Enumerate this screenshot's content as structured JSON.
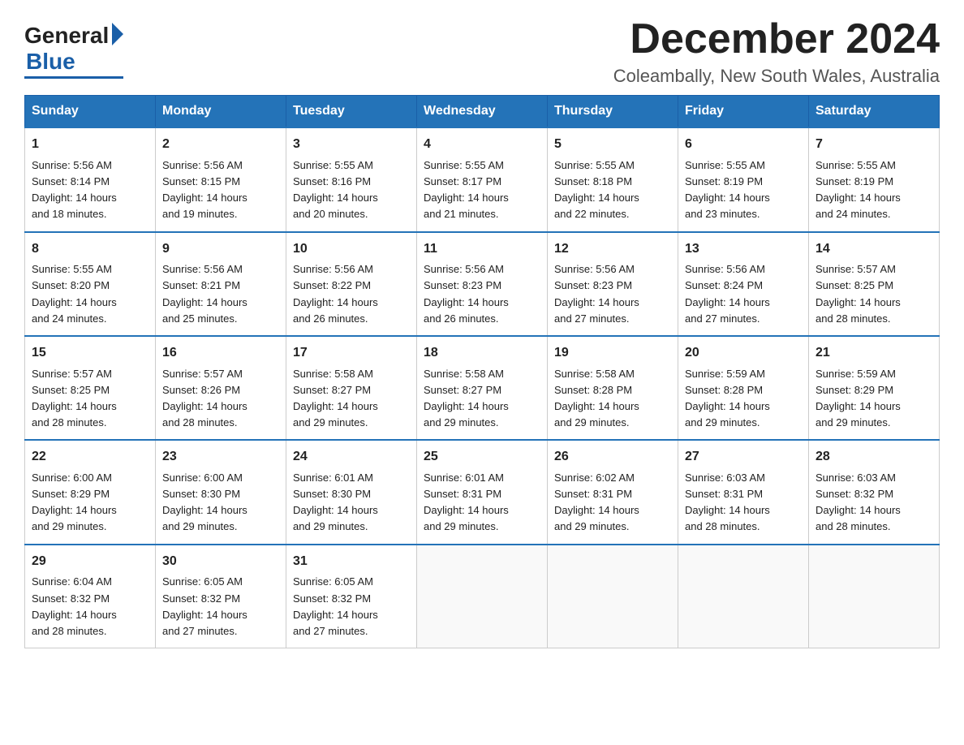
{
  "header": {
    "logo_general": "General",
    "logo_blue": "Blue",
    "month_title": "December 2024",
    "location": "Coleambally, New South Wales, Australia"
  },
  "days_of_week": [
    "Sunday",
    "Monday",
    "Tuesday",
    "Wednesday",
    "Thursday",
    "Friday",
    "Saturday"
  ],
  "weeks": [
    [
      {
        "day": "1",
        "sunrise": "5:56 AM",
        "sunset": "8:14 PM",
        "daylight": "14 hours and 18 minutes."
      },
      {
        "day": "2",
        "sunrise": "5:56 AM",
        "sunset": "8:15 PM",
        "daylight": "14 hours and 19 minutes."
      },
      {
        "day": "3",
        "sunrise": "5:55 AM",
        "sunset": "8:16 PM",
        "daylight": "14 hours and 20 minutes."
      },
      {
        "day": "4",
        "sunrise": "5:55 AM",
        "sunset": "8:17 PM",
        "daylight": "14 hours and 21 minutes."
      },
      {
        "day": "5",
        "sunrise": "5:55 AM",
        "sunset": "8:18 PM",
        "daylight": "14 hours and 22 minutes."
      },
      {
        "day": "6",
        "sunrise": "5:55 AM",
        "sunset": "8:19 PM",
        "daylight": "14 hours and 23 minutes."
      },
      {
        "day": "7",
        "sunrise": "5:55 AM",
        "sunset": "8:19 PM",
        "daylight": "14 hours and 24 minutes."
      }
    ],
    [
      {
        "day": "8",
        "sunrise": "5:55 AM",
        "sunset": "8:20 PM",
        "daylight": "14 hours and 24 minutes."
      },
      {
        "day": "9",
        "sunrise": "5:56 AM",
        "sunset": "8:21 PM",
        "daylight": "14 hours and 25 minutes."
      },
      {
        "day": "10",
        "sunrise": "5:56 AM",
        "sunset": "8:22 PM",
        "daylight": "14 hours and 26 minutes."
      },
      {
        "day": "11",
        "sunrise": "5:56 AM",
        "sunset": "8:23 PM",
        "daylight": "14 hours and 26 minutes."
      },
      {
        "day": "12",
        "sunrise": "5:56 AM",
        "sunset": "8:23 PM",
        "daylight": "14 hours and 27 minutes."
      },
      {
        "day": "13",
        "sunrise": "5:56 AM",
        "sunset": "8:24 PM",
        "daylight": "14 hours and 27 minutes."
      },
      {
        "day": "14",
        "sunrise": "5:57 AM",
        "sunset": "8:25 PM",
        "daylight": "14 hours and 28 minutes."
      }
    ],
    [
      {
        "day": "15",
        "sunrise": "5:57 AM",
        "sunset": "8:25 PM",
        "daylight": "14 hours and 28 minutes."
      },
      {
        "day": "16",
        "sunrise": "5:57 AM",
        "sunset": "8:26 PM",
        "daylight": "14 hours and 28 minutes."
      },
      {
        "day": "17",
        "sunrise": "5:58 AM",
        "sunset": "8:27 PM",
        "daylight": "14 hours and 29 minutes."
      },
      {
        "day": "18",
        "sunrise": "5:58 AM",
        "sunset": "8:27 PM",
        "daylight": "14 hours and 29 minutes."
      },
      {
        "day": "19",
        "sunrise": "5:58 AM",
        "sunset": "8:28 PM",
        "daylight": "14 hours and 29 minutes."
      },
      {
        "day": "20",
        "sunrise": "5:59 AM",
        "sunset": "8:28 PM",
        "daylight": "14 hours and 29 minutes."
      },
      {
        "day": "21",
        "sunrise": "5:59 AM",
        "sunset": "8:29 PM",
        "daylight": "14 hours and 29 minutes."
      }
    ],
    [
      {
        "day": "22",
        "sunrise": "6:00 AM",
        "sunset": "8:29 PM",
        "daylight": "14 hours and 29 minutes."
      },
      {
        "day": "23",
        "sunrise": "6:00 AM",
        "sunset": "8:30 PM",
        "daylight": "14 hours and 29 minutes."
      },
      {
        "day": "24",
        "sunrise": "6:01 AM",
        "sunset": "8:30 PM",
        "daylight": "14 hours and 29 minutes."
      },
      {
        "day": "25",
        "sunrise": "6:01 AM",
        "sunset": "8:31 PM",
        "daylight": "14 hours and 29 minutes."
      },
      {
        "day": "26",
        "sunrise": "6:02 AM",
        "sunset": "8:31 PM",
        "daylight": "14 hours and 29 minutes."
      },
      {
        "day": "27",
        "sunrise": "6:03 AM",
        "sunset": "8:31 PM",
        "daylight": "14 hours and 28 minutes."
      },
      {
        "day": "28",
        "sunrise": "6:03 AM",
        "sunset": "8:32 PM",
        "daylight": "14 hours and 28 minutes."
      }
    ],
    [
      {
        "day": "29",
        "sunrise": "6:04 AM",
        "sunset": "8:32 PM",
        "daylight": "14 hours and 28 minutes."
      },
      {
        "day": "30",
        "sunrise": "6:05 AM",
        "sunset": "8:32 PM",
        "daylight": "14 hours and 27 minutes."
      },
      {
        "day": "31",
        "sunrise": "6:05 AM",
        "sunset": "8:32 PM",
        "daylight": "14 hours and 27 minutes."
      },
      null,
      null,
      null,
      null
    ]
  ],
  "labels": {
    "sunrise": "Sunrise: ",
    "sunset": "Sunset: ",
    "daylight": "Daylight: "
  }
}
